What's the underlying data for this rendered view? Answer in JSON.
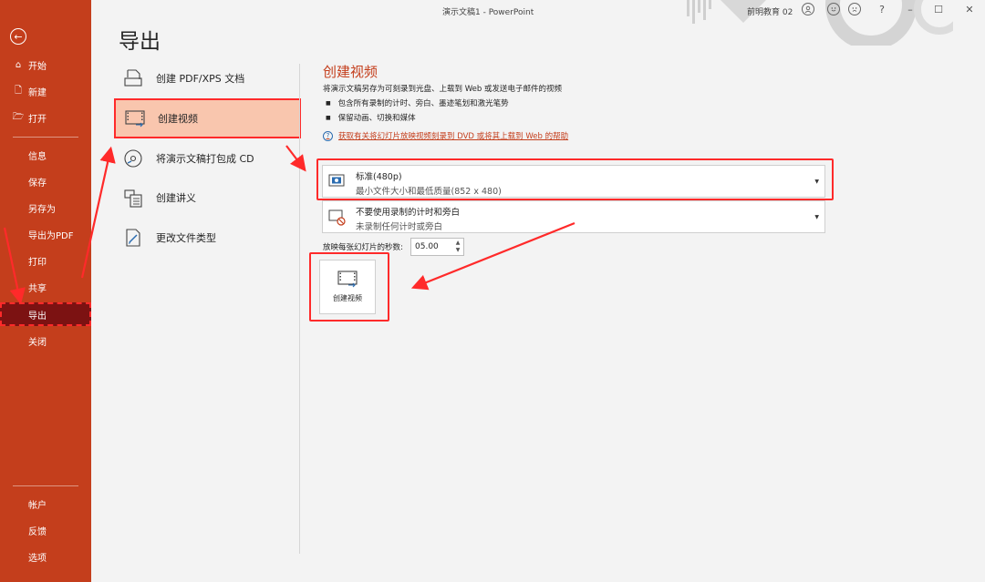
{
  "window": {
    "title": "演示文稿1  -  PowerPoint",
    "user": "前明教育 02",
    "help_label": "?",
    "min_label": "–",
    "max_label": "☐",
    "close_label": "✕"
  },
  "sidebar": {
    "back_label": "←",
    "top_items": [
      {
        "icon": "⌂",
        "label": "开始"
      },
      {
        "icon": "🗋",
        "label": "新建"
      },
      {
        "icon": "🗁",
        "label": "打开"
      }
    ],
    "mid_items": [
      "信息",
      "保存",
      "另存为",
      "导出为PDF",
      "打印",
      "共享",
      "导出",
      "关闭"
    ],
    "active": "导出",
    "bottom_items": [
      "帐户",
      "反馈",
      "选项"
    ]
  },
  "page_title": "导出",
  "export_options": [
    {
      "label": "创建 PDF/XPS 文档",
      "icon": "pdf-document-icon"
    },
    {
      "label": "创建视频",
      "icon": "video-film-icon"
    },
    {
      "label": "将演示文稿打包成 CD",
      "icon": "cd-disc-icon"
    },
    {
      "label": "创建讲义",
      "icon": "handout-icon"
    },
    {
      "label": "更改文件类型",
      "icon": "change-file-type-icon"
    }
  ],
  "selected_option": "创建视频",
  "detail": {
    "title": "创建视频",
    "description": "将演示文稿另存为可刻录到光盘、上载到 Web 或发送电子邮件的视频",
    "bullets": [
      "包含所有录制的计时、旁白、墨迹笔划和激光笔势",
      "保留动画、切换和媒体"
    ],
    "help_link": "获取有关将幻灯片放映视频刻录到 DVD 或将其上载到 Web 的帮助",
    "quality": {
      "main": "标准(480p)",
      "sub": "最小文件大小和最低质量(852 x 480)"
    },
    "timing": {
      "main": "不要使用录制的计时和旁白",
      "sub": "未录制任何计时或旁白"
    },
    "seconds_label": "放映每张幻灯片的秒数:",
    "seconds_value": "05.00",
    "create_button": "创建视频"
  },
  "colors": {
    "accent": "#c43e1c",
    "active_sidebar": "#7c1212",
    "highlight": "#ff2a2a",
    "selected_bg": "#f9c6ae"
  }
}
